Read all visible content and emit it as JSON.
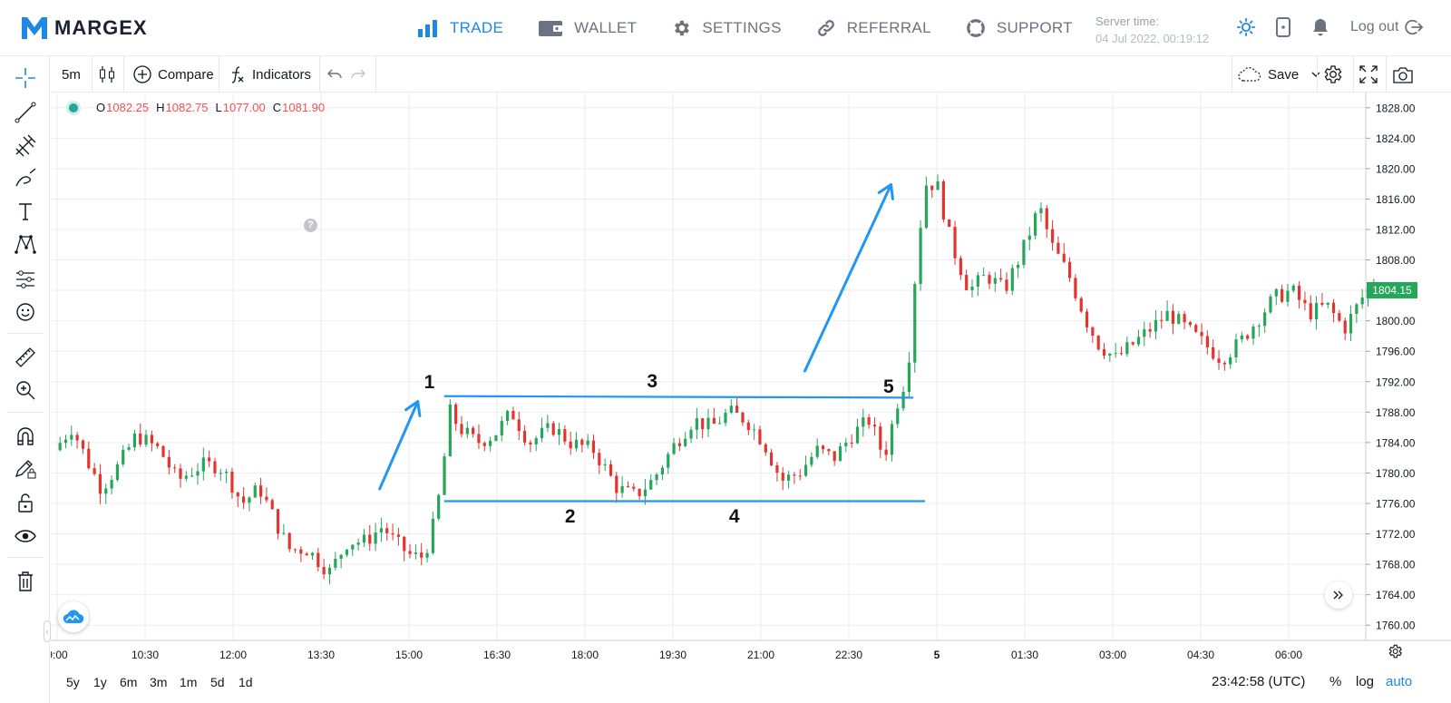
{
  "brand": {
    "name": "MARGEX",
    "logo_color": "#1e88e5"
  },
  "nav": [
    {
      "label": "TRADE",
      "icon": "bar-chart-icon",
      "active": true
    },
    {
      "label": "WALLET",
      "icon": "wallet-icon",
      "active": false
    },
    {
      "label": "SETTINGS",
      "icon": "gear-icon",
      "active": false
    },
    {
      "label": "REFERRAL",
      "icon": "link-icon",
      "active": false
    },
    {
      "label": "SUPPORT",
      "icon": "lifebuoy-icon",
      "active": false
    }
  ],
  "server": {
    "label": "Server time:",
    "value": "04 Jul 2022, 00:19:12"
  },
  "header": {
    "logout_label": "Log out"
  },
  "toolbar": {
    "interval": "5m",
    "compare_label": "Compare",
    "indicators_label": "Indicators",
    "save_label": "Save"
  },
  "legend": {
    "o_label": "O",
    "o": "1082.25",
    "h_label": "H",
    "h": "1082.75",
    "l_label": "L",
    "l": "1077.00",
    "c_label": "C",
    "c": "1081.90"
  },
  "price_badge": "1804.15",
  "bottom": {
    "ranges": [
      "5y",
      "1y",
      "6m",
      "3m",
      "1m",
      "5d",
      "1d"
    ],
    "utc_time": "23:42:58 (UTC)",
    "percent": "%",
    "log": "log",
    "auto": "auto"
  },
  "annotations": [
    "1",
    "2",
    "3",
    "4",
    "5"
  ],
  "colors": {
    "up": "#26a65b",
    "down": "#e5332d",
    "accent": "#1e88e5",
    "annotation_line": "#2196f3"
  },
  "chart_data": {
    "type": "candlestick",
    "y_ticks": [
      "1828.00",
      "1824.00",
      "1820.00",
      "1816.00",
      "1812.00",
      "1808.00",
      "1804.00",
      "1800.00",
      "1796.00",
      "1792.00",
      "1788.00",
      "1784.00",
      "1780.00",
      "1776.00",
      "1772.00",
      "1768.00",
      "1764.00",
      "1760.00"
    ],
    "ylim": [
      1758,
      1830
    ],
    "x_ticks": [
      {
        "label": "9:00",
        "t": 0
      },
      {
        "label": "10:30",
        "t": 1.5
      },
      {
        "label": "12:00",
        "t": 3
      },
      {
        "label": "13:30",
        "t": 4.5
      },
      {
        "label": "15:00",
        "t": 6
      },
      {
        "label": "16:30",
        "t": 7.5
      },
      {
        "label": "18:00",
        "t": 9
      },
      {
        "label": "19:30",
        "t": 10.5
      },
      {
        "label": "21:00",
        "t": 12
      },
      {
        "label": "22:30",
        "t": 13.5
      },
      {
        "label": "5",
        "t": 15
      },
      {
        "label": "01:30",
        "t": 16.5
      },
      {
        "label": "03:00",
        "t": 18
      },
      {
        "label": "04:30",
        "t": 19.5
      },
      {
        "label": "06:00",
        "t": 21
      }
    ],
    "xlim": [
      0,
      22.5
    ],
    "anchors": [
      [
        0.0,
        1783
      ],
      [
        0.3,
        1786
      ],
      [
        0.6,
        1781
      ],
      [
        0.8,
        1778
      ],
      [
        1.1,
        1781
      ],
      [
        1.4,
        1785
      ],
      [
        1.8,
        1783
      ],
      [
        2.1,
        1779
      ],
      [
        2.5,
        1781
      ],
      [
        2.8,
        1781
      ],
      [
        3.0,
        1779
      ],
      [
        3.2,
        1776
      ],
      [
        3.5,
        1778
      ],
      [
        4.0,
        1770
      ],
      [
        4.3,
        1770
      ],
      [
        4.7,
        1767
      ],
      [
        5.0,
        1771
      ],
      [
        5.3,
        1771
      ],
      [
        5.6,
        1773
      ],
      [
        5.8,
        1771
      ],
      [
        6.1,
        1769
      ],
      [
        6.3,
        1769
      ],
      [
        6.5,
        1774
      ],
      [
        6.6,
        1779
      ],
      [
        6.75,
        1788
      ],
      [
        6.9,
        1786
      ],
      [
        7.2,
        1784
      ],
      [
        7.5,
        1785
      ],
      [
        7.8,
        1788
      ],
      [
        8.1,
        1784
      ],
      [
        8.5,
        1786
      ],
      [
        8.8,
        1784
      ],
      [
        9.2,
        1783
      ],
      [
        9.6,
        1778
      ],
      [
        9.9,
        1777
      ],
      [
        10.2,
        1779
      ],
      [
        10.6,
        1784
      ],
      [
        10.9,
        1787
      ],
      [
        11.2,
        1786
      ],
      [
        11.5,
        1788
      ],
      [
        11.8,
        1787
      ],
      [
        12.1,
        1784
      ],
      [
        12.4,
        1779
      ],
      [
        12.7,
        1780
      ],
      [
        13.0,
        1783
      ],
      [
        13.3,
        1782
      ],
      [
        13.6,
        1785
      ],
      [
        13.9,
        1787
      ],
      [
        14.15,
        1782
      ],
      [
        14.4,
        1790
      ],
      [
        14.55,
        1793
      ],
      [
        14.7,
        1808
      ],
      [
        14.85,
        1818
      ],
      [
        15.05,
        1818
      ],
      [
        15.3,
        1810
      ],
      [
        15.6,
        1804
      ],
      [
        15.9,
        1806
      ],
      [
        16.2,
        1804
      ],
      [
        16.5,
        1809
      ],
      [
        16.8,
        1815
      ],
      [
        17.0,
        1810
      ],
      [
        17.3,
        1806
      ],
      [
        17.6,
        1800
      ],
      [
        17.8,
        1797
      ],
      [
        18.1,
        1795
      ],
      [
        18.4,
        1797
      ],
      [
        18.7,
        1799
      ],
      [
        19.0,
        1801
      ],
      [
        19.3,
        1799
      ],
      [
        19.6,
        1797
      ],
      [
        19.9,
        1795
      ],
      [
        20.2,
        1797
      ],
      [
        20.5,
        1800
      ],
      [
        20.8,
        1803
      ],
      [
        21.1,
        1804
      ],
      [
        21.4,
        1801
      ],
      [
        21.7,
        1802
      ],
      [
        22.0,
        1799
      ],
      [
        22.3,
        1803
      ],
      [
        22.5,
        1805
      ]
    ],
    "candle_count": 230,
    "annotation_lines": [
      {
        "t1": 6.6,
        "p1": 1790.1,
        "t2": 14.6,
        "p2": 1789.9
      },
      {
        "t1": 6.6,
        "p1": 1776.3,
        "t2": 14.8,
        "p2": 1776.3
      }
    ],
    "annotation_arrows": [
      {
        "t1": 5.5,
        "p1": 1777.9,
        "t2": 6.15,
        "p2": 1789.4
      },
      {
        "t1": 12.75,
        "p1": 1793.4,
        "t2": 14.22,
        "p2": 1817.9
      }
    ],
    "annotation_points": [
      {
        "label": "1",
        "t": 6.35,
        "p": 1791.9
      },
      {
        "label": "2",
        "t": 8.75,
        "p": 1774.2
      },
      {
        "label": "3",
        "t": 10.15,
        "p": 1792.0
      },
      {
        "label": "4",
        "t": 11.55,
        "p": 1774.2
      },
      {
        "label": "5",
        "t": 14.18,
        "p": 1791.3
      }
    ]
  }
}
